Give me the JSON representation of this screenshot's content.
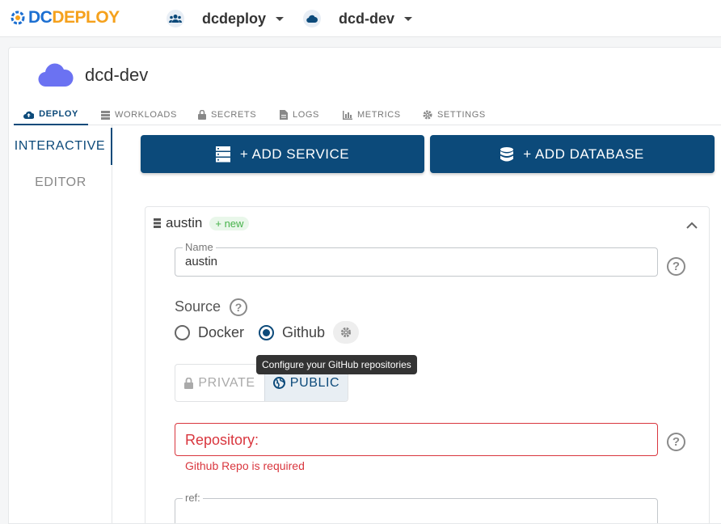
{
  "topbar": {
    "logo_dc": "DC",
    "logo_deploy": "DEPLOY",
    "org": {
      "label": "dcdeploy"
    },
    "env": {
      "label": "dcd-dev"
    }
  },
  "env_header": {
    "title": "dcd-dev"
  },
  "tabs": [
    {
      "label": "DEPLOY",
      "icon": "cloud-upload-icon",
      "active": true
    },
    {
      "label": "WORKLOADS",
      "icon": "server-icon",
      "active": false
    },
    {
      "label": "SECRETS",
      "icon": "lock-icon",
      "active": false
    },
    {
      "label": "LOGS",
      "icon": "document-icon",
      "active": false
    },
    {
      "label": "METRICS",
      "icon": "bar-chart-icon",
      "active": false
    },
    {
      "label": "SETTINGS",
      "icon": "gear-icon",
      "active": false
    }
  ],
  "sidenav": [
    {
      "label": "INTERACTIVE",
      "active": true
    },
    {
      "label": "EDITOR",
      "active": false
    }
  ],
  "actions": {
    "add_service": "+ ADD SERVICE",
    "add_database": "+ ADD DATABASE"
  },
  "service": {
    "name": "austin",
    "badge": "+ new",
    "name_field": {
      "label": "Name",
      "value": "austin"
    },
    "source_label": "Source",
    "source_options": [
      {
        "label": "Docker",
        "selected": false
      },
      {
        "label": "Github",
        "selected": true
      }
    ],
    "tooltip": "Configure your GitHub repositories",
    "visibility": {
      "private": "PRIVATE",
      "public": "PUBLIC",
      "selected": "PUBLIC"
    },
    "repository": {
      "label": "Repository:",
      "error": "Github Repo is required"
    },
    "ref_field": {
      "label": "ref:"
    }
  },
  "colors": {
    "primary": "#0c4a7a",
    "error": "#d9363e",
    "success": "#46b34a",
    "cloud": "#6b72f2"
  }
}
